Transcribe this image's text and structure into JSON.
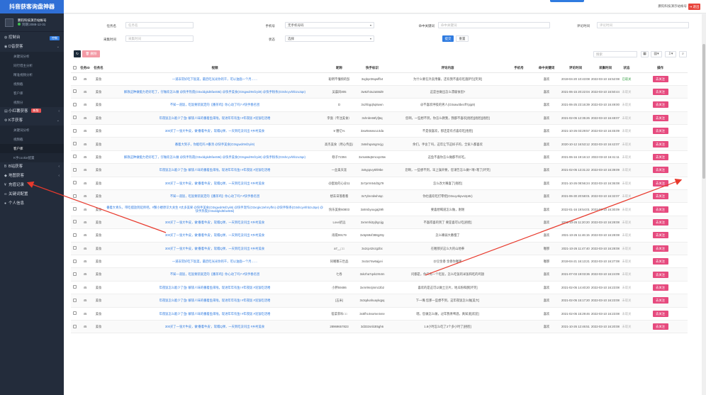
{
  "sidebar": {
    "title": "抖音获客询盘神器",
    "user_name": "鹏钧科技演示站帐号",
    "user_expire": "到期:2088-12-31",
    "menu": [
      {
        "label": "控制台",
        "icon": "dashboard-icon",
        "badge": "控制"
      },
      {
        "label": "D音获客",
        "icon": "eye-icon",
        "sub": [
          "关键词分析",
          "同行借主分析",
          "精准视频分析",
          "视频截",
          "客户库",
          "视频分"
        ]
      },
      {
        "label": "小红薯获客",
        "icon": "doc-icon",
        "badge": "新版"
      },
      {
        "label": "K手获客",
        "icon": "gear-icon",
        "sub": [
          "关键词分析",
          "视频截",
          "客户库",
          "K手cookie配置"
        ]
      },
      {
        "label": "B站获客",
        "icon": "bilibili-icon"
      },
      {
        "label": "地图获客",
        "icon": "map-pin-icon"
      },
      {
        "label": "充值记录",
        "icon": "yen-icon"
      },
      {
        "label": "关键词配置",
        "icon": "link-icon"
      },
      {
        "label": "个人信息",
        "icon": "user-icon"
      }
    ],
    "active_sub": "客户库"
  },
  "header": {
    "account": "鹏钧科技演示站帐号",
    "logout": "退出"
  },
  "filters": {
    "task_label": "任务名",
    "task_placeholder": "任务名",
    "phone_label": "手机号",
    "phone_value": "无手机号码",
    "keyword_label": "命中关键词",
    "keyword_placeholder": "命中关键词",
    "comment_time_label": "评论时间",
    "comment_time_placeholder": "评论时间",
    "collect_time_label": "采集时间",
    "collect_time_placeholder": "采集时间",
    "status_label": "状态",
    "status_value": "选择",
    "submit": "提交",
    "reset": "重置"
  },
  "toolbar": {
    "refresh": "刷新",
    "delete": "删除",
    "search_placeholder": "搜索"
  },
  "table": {
    "headers": [
      "",
      "任务ID",
      "任务名",
      "视频",
      "昵称",
      "快手标识",
      "评论内容",
      "手机号",
      "命中关键词",
      "评论时间",
      "采集时间",
      "状态",
      "操作"
    ],
    "op_label": "去关注",
    "rows": [
      {
        "id": "45",
        "task": "美妆",
        "video": "一道非常好吃下饭菜，最后吃光光你的干，可以油面一个月……",
        "nick": "聪明不懂烦的彭",
        "ks": "3xgbpr36qwffb4",
        "comment": "为什么要在外卖用餐，还有我不喜欢吃菌萨包[笑哭]",
        "phone": "",
        "kw": "喜欢",
        "ctime": "2019-04-20 10:43:08",
        "gtime": "2022-03-10 16:52:08",
        "status": "已取关",
        "ok": true
      },
      {
        "id": "45",
        "task": "美妆",
        "video": "解救这种做能力老好吃了，仔做欢怎么做 @快手热夜(O3xddgkd5fav5t6i) @快手美食(O3sgwdr9sfzyii9) @快手粉条(O3shcyvhhbzu3qe)",
        "nick": "吴晨风805",
        "ks": "3w6zh3u2a56d9",
        "comment": "这是台做出怎么漂献食因?",
        "phone": "",
        "kw": "喜欢",
        "ctime": "2021-06-15 20:22:04",
        "gtime": "2022-03-10 16:50:44",
        "status": "未取关",
        "ok": false
      },
      {
        "id": "45",
        "task": "美妆",
        "video": "不知一道饭，吃饭要装就定的【番茶鸡】你心动了吗? #快手春名团",
        "nick": "D",
        "ks": "3xzhbgqhq8uwn",
        "comment": "@不喜欢呼吸的男人(O3xaw3bezff7pjq9)",
        "phone": "",
        "kw": "喜欢",
        "ctime": "2021-06-25 23:16:39",
        "gtime": "2022-03-10 16:49:00",
        "status": "未取关",
        "ok": false
      },
      {
        "id": "45",
        "task": "美妆",
        "video": "年夜饭怎么能少了鱼! 解锁人味的番着鱼来啦。现进年年有鱼! #年夜饭 #泥饭吃话喽",
        "nick": "李面（专注美食）",
        "ks": "3xhnbn66fyfj6q",
        "comment": "您啊，一些想不到，你怎么教我，我都不喜欢[捂脸][捂脸][捂脸]",
        "phone": "",
        "kw": "喜欢",
        "ctime": "2021-02-05 12:35:26",
        "gtime": "2022-03-10 16:48:07",
        "status": "未取关",
        "ok": false
      },
      {
        "id": "45",
        "task": "美妆",
        "video": "300买了一张大牛皮，做'番着牛皮'，软糯Q弹，一天到吃没问出 #乡村美食",
        "nick": "¥ 膳亿%",
        "ks": "3xw8vwwvuc4da",
        "comment": "不是很喜欢，那还是有点喜欢吃[捂脸]",
        "phone": "",
        "kw": "喜欢",
        "ctime": "2021-10-26 03:29:57",
        "gtime": "2022-03-10 16:45:09",
        "status": "未取关",
        "ok": false
      },
      {
        "id": "45",
        "task": "美妆",
        "video": "番着大到子，你能吃吗 #番汤 @快手美食(O3sgwdr9sfzyii9)",
        "nick": "高杰美食（用心传品）",
        "ks": "3x6shqamgmcjg",
        "comment": "余们，手舍了吗，这年让节这样子的，全家人都喜欢",
        "phone": "",
        "kw": "喜欢",
        "ctime": "2020-10-12 16:53:12",
        "gtime": "2022-03-10 16:42:07",
        "status": "未取关",
        "ok": false
      },
      {
        "id": "45",
        "task": "美妆",
        "video": "解救这种做能力老好吃了，仔做欢怎么做 @快手热夜(O3xddgkd5fav5t6i) @快手美食(O3sgwdr9sfzyii9) @快手粉条(O3shcyvhhbzu3qe)",
        "nick": "巷子72394",
        "ks": "3xma66q5mcxpz8w",
        "comment": "这鱼不喜你怎么做都不好吃。",
        "phone": "",
        "kw": "喜欢",
        "ctime": "2021-06-16 19:16:13",
        "gtime": "2022-03-10 16:41:11",
        "status": "未取关",
        "ok": false
      },
      {
        "id": "45",
        "task": "美妆",
        "video": "年夜饭怎么能少了鱼! 解锁人味的番着鱼来啦。现进年年有鱼! #年夜饭 #泥饭吃话喽",
        "nick": "一丝柔天涯",
        "ks": "3x5yppvy5hl9be",
        "comment": "您啊，一些想不到，早上操开要，您请告怎么做? 晴! 嗯了[坏笑]",
        "phone": "",
        "kw": "喜欢",
        "ctime": "2021-02-05 13:31:22",
        "gtime": "2022-03-10 16:39:09",
        "status": "未取关",
        "ok": false
      },
      {
        "id": "45",
        "task": "美妆",
        "video": "300买了一张大牛皮，做'番着牛皮'，软糯Q弹，一天到吃没问出 #乡村美食",
        "nick": "@蛋幼的心@11",
        "ks": "3x7prrm54d3g79",
        "comment": "怎么改大嘴喜了[捂脸]",
        "phone": "",
        "kw": "喜欢",
        "ctime": "2021-10-26 08:56:24",
        "gtime": "2022-03-10 16:36:08",
        "status": "未取关",
        "ok": false
      },
      {
        "id": "45",
        "task": "美妆",
        "video": "不知一道饭，吃饭要装就定的【番茶鸡】你心动了吗? #快手春名团",
        "nick": "想去日落看看",
        "ks": "3x7ybn4dwh4qc",
        "comment": "你也喜欢吃打零把(O3xuy4kpvs2p8c)",
        "phone": "",
        "kw": "喜欢",
        "ctime": "2021-06-30 20:58:01",
        "gtime": "2022-03-10 16:32:07",
        "status": "未取关",
        "ok": false
      },
      {
        "id": "45",
        "task": "美妆",
        "video": "番着大青头，带吃摆放到延师吧。#蟹小楼原识大关生 #太多美果 @快手美食(O3sgwdr9sfzyii9) @快手宠作(O3xrgkc2ehrryffm) @快手粉条(O3shcyvhhbzu3qe) @快手热夜(O3xddgkd5fav5t6i)",
        "nick": "快乐美食60803",
        "ks": "3x8mbyougaj39h",
        "comment": "要喜想喝道怎么做，谢谢",
        "phone": "",
        "kw": "喜欢",
        "ctime": "2022-01-16 19:54:01",
        "gtime": "2022-03-10 16:30:09",
        "status": "未取关",
        "ok": false
      },
      {
        "id": "45",
        "task": "美妆",
        "video": "300买了一张大牛皮，做'番着牛皮'，软糯Q弹，一天到吃没问出 #乡村美食",
        "nick": "Love奶远",
        "ks": "3xmmhi2pjhgcijg",
        "comment": "不喜得喜的到了 要是喜可以吃[捂脸]",
        "phone": "",
        "kw": "喜欢",
        "ctime": "2021-10-26 11:20:20",
        "gtime": "2022-03-10 16:28:08",
        "status": "未取关",
        "ok": false
      },
      {
        "id": "45",
        "task": "美妆",
        "video": "300买了一张大牛皮，做'番着牛皮'，软糯Q弹，一天到吃没问出 #乡村美食",
        "nick": "雨夜99179",
        "ks": "3x5p59xf388g29y",
        "comment": "怎么嘴弱大番慢了",
        "phone": "",
        "kw": "喜欢",
        "ctime": "2021-10-26 11:46:15",
        "gtime": "2022-03-10 16:28:08",
        "status": "未取关",
        "ok": false
      },
      {
        "id": "45",
        "task": "美妆",
        "video": "300买了一张大牛皮，做'番着牛皮'，软糯Q弹，一天到吃没问出 #乡村美食",
        "nick": "a7__□□",
        "ks": "3x2cp42szg2bc",
        "comment": "在喔那买这么大的山地拳",
        "phone": "",
        "kw": "喔那",
        "ctime": "2021-10-26 11:47:40",
        "gtime": "2022-03-10 16:28:08",
        "status": "未取关",
        "ok": false
      },
      {
        "id": "45",
        "task": "美妆",
        "video": "一道非常好吃下饭菜，最后吃光光你的干，可以油面一个月……",
        "nick": "同噶寨三世品",
        "ks": "3xcta74w6ajyei",
        "comment": "炒豆金香 金香你喔那",
        "phone": "",
        "kw": "喔那",
        "ctime": "2019-04-21 16:13:21",
        "gtime": "2022-03-10 16:27:08",
        "status": "未取关",
        "ok": false
      },
      {
        "id": "45",
        "task": "美妆",
        "video": "不知一道饭，吃饭要装就定的【番茶鸡】你心动了吗? #快手春名团",
        "nick": "七各",
        "ks": "3xkzha7qvk2r64m",
        "comment": "问都是，你只有一个吃饭，怎么吃饭的米饭和吃的鸡翅",
        "phone": "",
        "kw": "喜欢",
        "ctime": "2021-07-03 19:03:36",
        "gtime": "2022-03-10 16:24:09",
        "status": "未取关",
        "ok": false
      },
      {
        "id": "45",
        "task": "美妆",
        "video": "年夜饭怎么能少了鱼! 解锁人味的番着鱼来啦。现进年年有鱼! #年夜饭 #泥饭吃话喽",
        "nick": "小胖59486",
        "ks": "3xmr9n4jmmz2b2",
        "comment": "喜欢的是这可以做土豆片，地瓜粉和酵[坏笑]",
        "phone": "",
        "kw": "喜欢",
        "ctime": "2021-02-05 14:40:20",
        "gtime": "2022-03-10 16:23:08",
        "status": "未取关",
        "ok": false
      },
      {
        "id": "45",
        "task": "美妆",
        "video": "年夜饭怎么能少了鱼! 解锁人味的番着鱼来啦。现进年年有鱼! #年夜饭 #泥饭吃话喽",
        "nick": "(五米)",
        "ks": "3x3qdvahuaykqpq",
        "comment": "下一嘴 您那一些想不到，这年夜饭怎么做[美大]",
        "phone": "",
        "kw": "喜欢",
        "ctime": "2021-02-05 15:17:20",
        "gtime": "2022-03-10 16:23:08",
        "status": "未取关",
        "ok": false
      },
      {
        "id": "45",
        "task": "美妆",
        "video": "年夜饭怎么能少了鱼! 解锁人味的番着鱼来啦。现进年年有鱼! #年夜饭 #泥饭吃话喽",
        "nick": "蓓菜菲咔□□",
        "ks": "3x5fhc4vwme4vne",
        "comment": "嗯，您做怎么做，过年我青啤酒，真知道[欢迎]",
        "phone": "",
        "kw": "喜欢",
        "ctime": "2021-02-05 15:29:46",
        "gtime": "2022-03-10 16:23:08",
        "status": "未取关",
        "ok": false
      },
      {
        "id": "45",
        "task": "美妆",
        "video": "300买了一张大牛皮，做'番着牛皮'，软糯Q弹，一天到吃没问出 #乡村美食",
        "nick": "28969657823",
        "ks": "3d332snb3t5gh6",
        "comment": "1.8小时怎么吃了2个多小时了[捂脸]",
        "phone": "",
        "kw": "喜欢",
        "ctime": "2021-10-26 12:46:51",
        "gtime": "2022-03-10 16:20:08",
        "status": "未取关",
        "ok": false
      }
    ]
  }
}
